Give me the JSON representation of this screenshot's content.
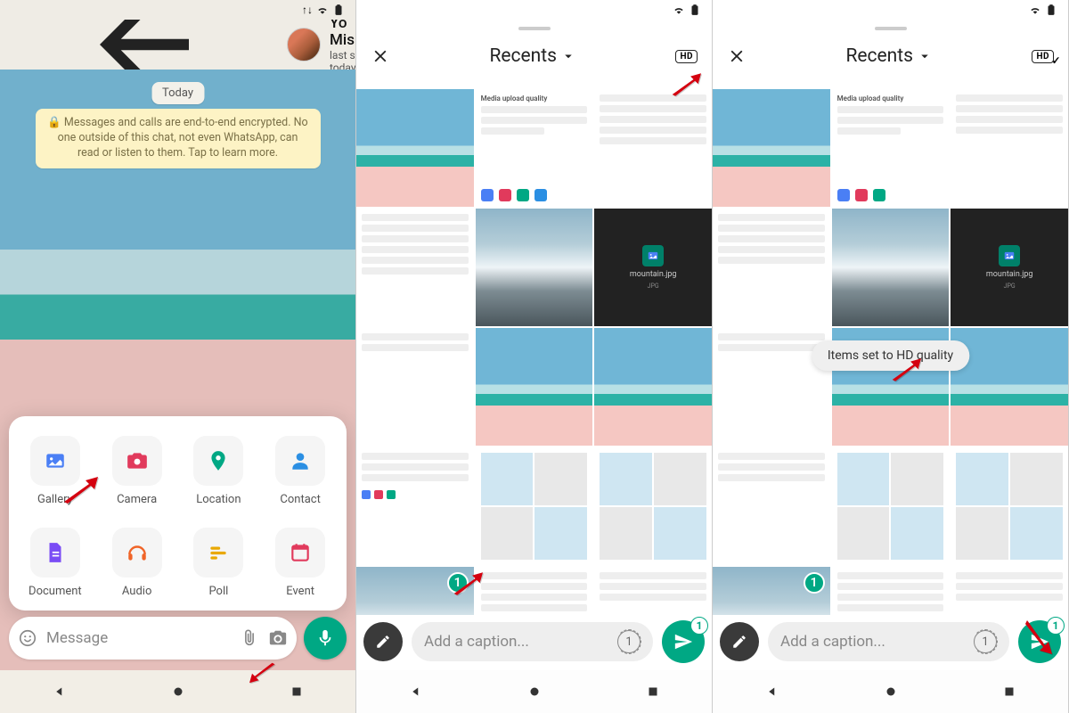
{
  "panel1": {
    "status": {
      "arrows_icon": "↕",
      "wifi": "wifi",
      "battery": "battery"
    },
    "header": {
      "name": "Yo Mismo",
      "last_seen": "last seen today"
    },
    "date_chip": "Today",
    "encryption_notice": "Messages and calls are end-to-end encrypted. No one outside of this chat, not even WhatsApp, can read or listen to them. Tap to learn more.",
    "attach": {
      "gallery": "Gallery",
      "camera": "Camera",
      "location": "Location",
      "contact": "Contact",
      "document": "Document",
      "audio": "Audio",
      "poll": "Poll",
      "event": "Event"
    },
    "input_placeholder": "Message"
  },
  "panel2": {
    "title": "Recents",
    "hd_label": "HD",
    "caption_placeholder": "Add a caption...",
    "selected_count": "1",
    "send_count": "1",
    "quality_title": "Media upload quality",
    "thumb_file": "mountain.jpg",
    "thumb_file_meta": "JPG"
  },
  "panel3": {
    "title": "Recents",
    "hd_label": "HD",
    "toast": "Items set to HD quality",
    "caption_placeholder": "Add a caption...",
    "selected_count": "1",
    "send_count": "1",
    "quality_title": "Media upload quality",
    "thumb_file": "mountain.jpg",
    "thumb_file_meta": "JPG"
  },
  "viewonce_label": "1"
}
